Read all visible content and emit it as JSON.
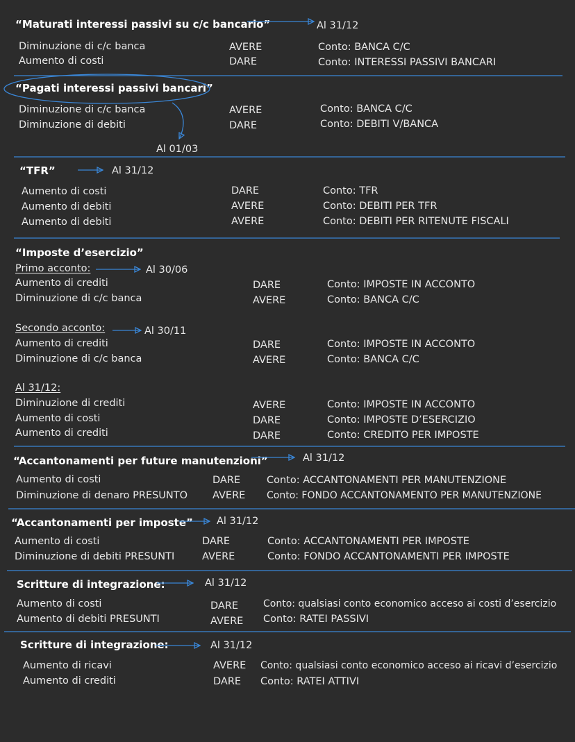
{
  "sections": [
    {
      "title": "“Maturati interessi passivi su c/c bancario”",
      "date": "Al 31/12",
      "rows": [
        {
          "desc": "Diminuzione di c/c banca",
          "side": "AVERE",
          "conto": "Conto: BANCA C/C"
        },
        {
          "desc": "Aumento di costi",
          "side": "DARE",
          "conto": "Conto: INTERESSI PASSIVI BANCARI"
        }
      ]
    },
    {
      "title": "“Pagati interessi passivi bancari”",
      "date": "Al 01/03",
      "rows": [
        {
          "desc": "Diminuzione di c/c banca",
          "side": "AVERE",
          "conto": "Conto: BANCA C/C"
        },
        {
          "desc": "Diminuzione di debiti",
          "side": "DARE",
          "conto": "Conto: DEBITI V/BANCA"
        }
      ]
    },
    {
      "title": "“TFR”",
      "date": "Al 31/12",
      "rows": [
        {
          "desc": "Aumento di costi",
          "side": "DARE",
          "conto": "Conto: TFR"
        },
        {
          "desc": "Aumento di debiti",
          "side": "AVERE",
          "conto": "Conto: DEBITI PER TFR"
        },
        {
          "desc": "Aumento di debiti",
          "side": "AVERE",
          "conto": "Conto: DEBITI PER RITENUTE FISCALI"
        }
      ]
    },
    {
      "title": "“Imposte d’esercizio”",
      "groups": [
        {
          "label": "Primo acconto:",
          "date": "Al 30/06",
          "rows": [
            {
              "desc": "Aumento di crediti",
              "side": "DARE",
              "conto": "Conto: IMPOSTE IN ACCONTO"
            },
            {
              "desc": "Diminuzione di c/c banca",
              "side": "AVERE",
              "conto": "Conto: BANCA C/C"
            }
          ]
        },
        {
          "label": "Secondo acconto:",
          "date": "Al 30/11",
          "rows": [
            {
              "desc": "Aumento di crediti",
              "side": "DARE",
              "conto": "Conto: IMPOSTE IN ACCONTO"
            },
            {
              "desc": "Diminuzione di c/c banca",
              "side": "AVERE",
              "conto": "Conto: BANCA C/C"
            }
          ]
        },
        {
          "label": "Al 31/12:",
          "rows": [
            {
              "desc": "Diminuzione di crediti",
              "side": "AVERE",
              "conto": "Conto: IMPOSTE IN ACCONTO"
            },
            {
              "desc": "Aumento di costi",
              "side": "DARE",
              "conto": "Conto: IMPOSTE D’ESERCIZIO"
            },
            {
              "desc": "Aumento di crediti",
              "side": "DARE",
              "conto": "Conto: CREDITO PER IMPOSTE"
            }
          ]
        }
      ]
    },
    {
      "title": "“Accantonamenti per future manutenzioni”",
      "date": "Al 31/12",
      "rows": [
        {
          "desc": "Aumento di costi",
          "side": "DARE",
          "conto": "Conto: ACCANTONAMENTI PER MANUTENZIONE"
        },
        {
          "desc": "Diminuzione di denaro PRESUNTO",
          "side": "AVERE",
          "conto": "Conto: FONDO ACCANTONAMENTO PER MANUTENZIONE"
        }
      ]
    },
    {
      "title": "“Accantonamenti per imposte”",
      "date": "Al 31/12",
      "rows": [
        {
          "desc": "Aumento di costi",
          "side": "DARE",
          "conto": "Conto: ACCANTONAMENTI PER IMPOSTE"
        },
        {
          "desc": "Diminuzione di debiti PRESUNTI",
          "side": "AVERE",
          "conto": "Conto: FONDO ACCANTONAMENTI PER IMPOSTE"
        }
      ]
    },
    {
      "title": "Scritture di integrazione:",
      "date": "Al 31/12",
      "rows": [
        {
          "desc": "Aumento di costi",
          "side": "DARE",
          "conto": "Conto: qualsiasi conto economico acceso ai costi d’esercizio"
        },
        {
          "desc": "Aumento di debiti PRESUNTI",
          "side": "AVERE",
          "conto": "Conto: RATEI PASSIVI"
        }
      ]
    },
    {
      "title": "Scritture di integrazione:",
      "date": "Al 31/12",
      "rows": [
        {
          "desc": "Aumento di ricavi",
          "side": "AVERE",
          "conto": "Conto: qualsiasi conto economico acceso ai ricavi d’esercizio"
        },
        {
          "desc": "Aumento di crediti",
          "side": "DARE",
          "conto": "Conto: RATEI ATTIVI"
        }
      ]
    }
  ],
  "colors": {
    "background": "#2c2c2c",
    "text": "#e8e8e8",
    "accent_blue": "#3a86d6"
  }
}
